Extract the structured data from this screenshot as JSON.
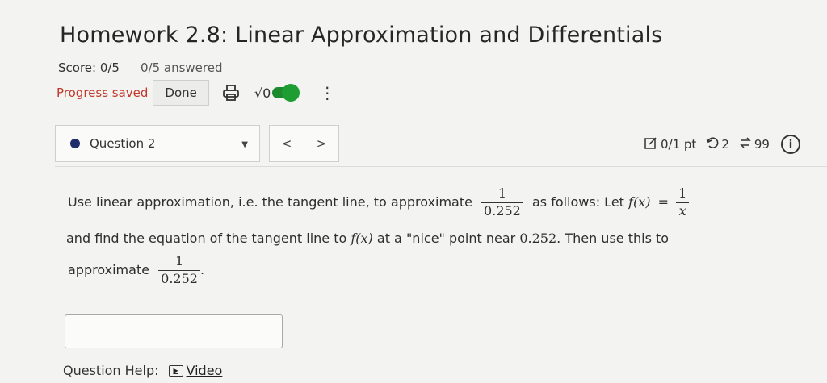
{
  "header": {
    "title": "Homework 2.8: Linear Approximation and Differentials",
    "score": "Score: 0/5",
    "answered": "0/5 answered",
    "progress_saved": "Progress saved",
    "done_label": "Done",
    "math_toggle_label": "√0"
  },
  "question_nav": {
    "selected": "Question 2",
    "prev": "<",
    "next": ">",
    "points": "0/1 pt",
    "retries": "2",
    "attempts": "99"
  },
  "question": {
    "t1": "Use linear approximation, i.e. the tangent line, to approximate",
    "frac_num": "1",
    "frac_den": "0.252",
    "t2": "as follows: Let",
    "fx": "f(x)",
    "eq": "=",
    "fx_num": "1",
    "fx_den": "x",
    "t3": "and find the equation of the tangent line to",
    "fx2": "f(x)",
    "t4": "at a \"nice\" point near",
    "near_val": "0.252",
    "t5": ". Then use this to",
    "t6": "approximate",
    "frac2_num": "1",
    "frac2_den": "0.252",
    "t7": "."
  },
  "answer": {
    "value": ""
  },
  "help": {
    "label": "Question Help:",
    "video_label": "Video"
  },
  "colors": {
    "progress_saved": "#c0392b",
    "toggle": "#1e9d33",
    "question_dot": "#1f2d6b"
  }
}
